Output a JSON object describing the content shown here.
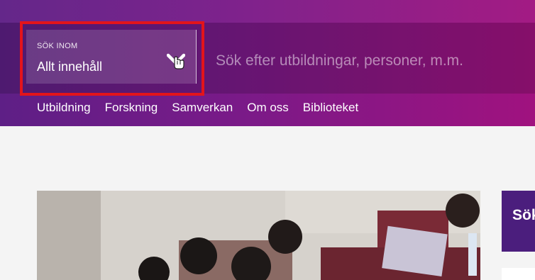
{
  "search": {
    "scope_caption": "SÖK INOM",
    "scope_value": "Allt innehåll",
    "placeholder": "Sök efter utbildningar, personer, m.m."
  },
  "nav": {
    "items": [
      {
        "label": "Utbildning"
      },
      {
        "label": "Forskning"
      },
      {
        "label": "Samverkan"
      },
      {
        "label": "Om oss"
      },
      {
        "label": "Biblioteket"
      }
    ]
  },
  "sidebar": {
    "card_title": "Sök"
  },
  "colors": {
    "header_start": "#5e1f86",
    "header_end": "#a0127f",
    "highlight": "#e3141b",
    "card": "#4b1e7d"
  },
  "icons": {
    "scope_toggle": "chevron-down-icon",
    "cursor": "hand-pointer-icon"
  }
}
